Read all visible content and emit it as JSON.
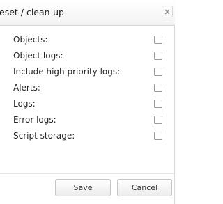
{
  "dialog": {
    "title": "eset / clean-up",
    "close_icon": "close-icon"
  },
  "options": [
    {
      "label": "Objects:",
      "checked": false
    },
    {
      "label": "Object logs:",
      "checked": false
    },
    {
      "label": "Include high priority logs:",
      "checked": false
    },
    {
      "label": "Alerts:",
      "checked": false
    },
    {
      "label": "Logs:",
      "checked": false
    },
    {
      "label": "Error logs:",
      "checked": false
    },
    {
      "label": "Script storage:",
      "checked": false
    }
  ],
  "buttons": {
    "save_label": "Save",
    "cancel_label": "Cancel"
  }
}
